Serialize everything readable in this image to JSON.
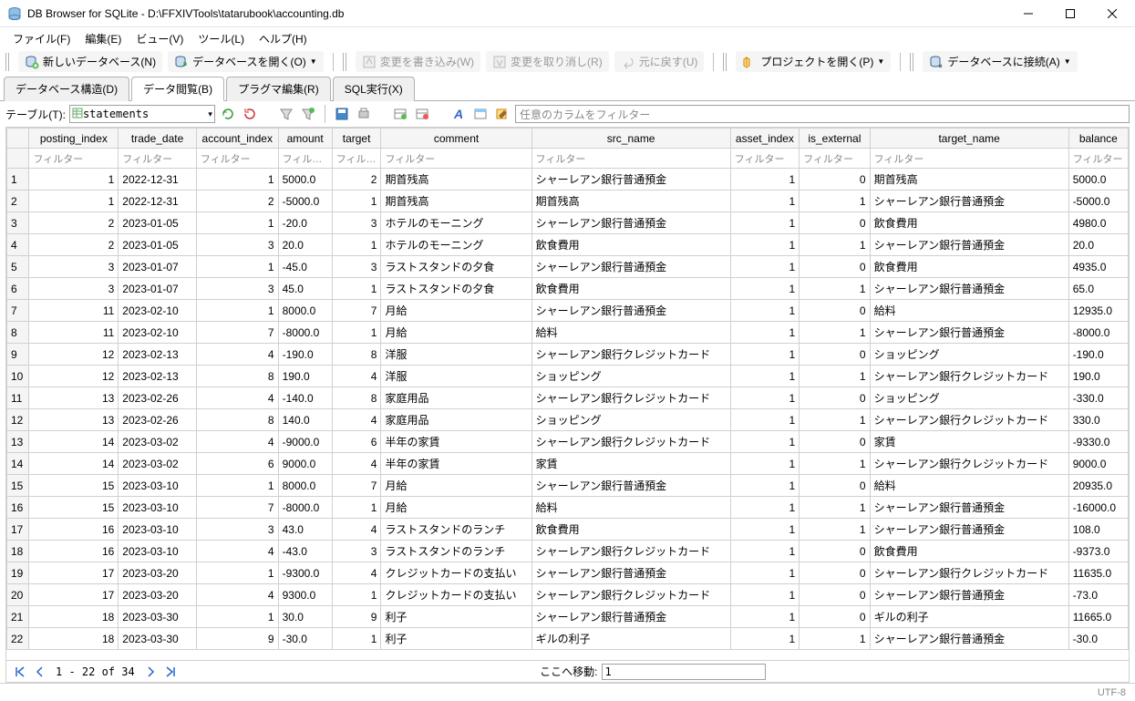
{
  "window": {
    "title": "DB Browser for SQLite - D:\\FFXIVTools\\tatarubook\\accounting.db"
  },
  "menus": {
    "file": "ファイル(F)",
    "edit": "編集(E)",
    "view": "ビュー(V)",
    "tools": "ツール(L)",
    "help": "ヘルプ(H)"
  },
  "toolbar": {
    "new_db": "新しいデータベース(N)",
    "open_db": "データベースを開く(O)",
    "write_changes": "変更を書き込み(W)",
    "revert_changes": "変更を取り消し(R)",
    "undo": "元に戻す(U)",
    "open_project": "プロジェクトを開く(P)",
    "attach_db": "データベースに接続(A)"
  },
  "tabs": {
    "structure": "データベース構造(D)",
    "browse": "データ閲覧(B)",
    "pragma": "プラグマ編集(R)",
    "sql": "SQL実行(X)"
  },
  "browse": {
    "table_label": "テーブル(T):",
    "table_name": "statements",
    "filter_placeholder": "任意のカラムをフィルター",
    "filter_cell": "フィルター",
    "filter_cell_short": "フィル…"
  },
  "columns": [
    "posting_index",
    "trade_date",
    "account_index",
    "amount",
    "target",
    "comment",
    "src_name",
    "asset_index",
    "is_external",
    "target_name",
    "balance"
  ],
  "rows": [
    {
      "n": "1",
      "posting_index": "1",
      "trade_date": "2022-12-31",
      "account_index": "1",
      "amount": "5000.0",
      "target": "2",
      "comment": "期首残高",
      "src_name": "シャーレアン銀行普通預金",
      "asset_index": "1",
      "is_external": "0",
      "target_name": "期首残高",
      "balance": "5000.0"
    },
    {
      "n": "2",
      "posting_index": "1",
      "trade_date": "2022-12-31",
      "account_index": "2",
      "amount": "-5000.0",
      "target": "1",
      "comment": "期首残高",
      "src_name": "期首残高",
      "asset_index": "1",
      "is_external": "1",
      "target_name": "シャーレアン銀行普通預金",
      "balance": "-5000.0"
    },
    {
      "n": "3",
      "posting_index": "2",
      "trade_date": "2023-01-05",
      "account_index": "1",
      "amount": "-20.0",
      "target": "3",
      "comment": "ホテルのモーニング",
      "src_name": "シャーレアン銀行普通預金",
      "asset_index": "1",
      "is_external": "0",
      "target_name": "飲食費用",
      "balance": "4980.0"
    },
    {
      "n": "4",
      "posting_index": "2",
      "trade_date": "2023-01-05",
      "account_index": "3",
      "amount": "20.0",
      "target": "1",
      "comment": "ホテルのモーニング",
      "src_name": "飲食費用",
      "asset_index": "1",
      "is_external": "1",
      "target_name": "シャーレアン銀行普通預金",
      "balance": "20.0"
    },
    {
      "n": "5",
      "posting_index": "3",
      "trade_date": "2023-01-07",
      "account_index": "1",
      "amount": "-45.0",
      "target": "3",
      "comment": "ラストスタンドの夕食",
      "src_name": "シャーレアン銀行普通預金",
      "asset_index": "1",
      "is_external": "0",
      "target_name": "飲食費用",
      "balance": "4935.0"
    },
    {
      "n": "6",
      "posting_index": "3",
      "trade_date": "2023-01-07",
      "account_index": "3",
      "amount": "45.0",
      "target": "1",
      "comment": "ラストスタンドの夕食",
      "src_name": "飲食費用",
      "asset_index": "1",
      "is_external": "1",
      "target_name": "シャーレアン銀行普通預金",
      "balance": "65.0"
    },
    {
      "n": "7",
      "posting_index": "11",
      "trade_date": "2023-02-10",
      "account_index": "1",
      "amount": "8000.0",
      "target": "7",
      "comment": "月給",
      "src_name": "シャーレアン銀行普通預金",
      "asset_index": "1",
      "is_external": "0",
      "target_name": "給料",
      "balance": "12935.0"
    },
    {
      "n": "8",
      "posting_index": "11",
      "trade_date": "2023-02-10",
      "account_index": "7",
      "amount": "-8000.0",
      "target": "1",
      "comment": "月給",
      "src_name": "給料",
      "asset_index": "1",
      "is_external": "1",
      "target_name": "シャーレアン銀行普通預金",
      "balance": "-8000.0"
    },
    {
      "n": "9",
      "posting_index": "12",
      "trade_date": "2023-02-13",
      "account_index": "4",
      "amount": "-190.0",
      "target": "8",
      "comment": "洋服",
      "src_name": "シャーレアン銀行クレジットカード",
      "asset_index": "1",
      "is_external": "0",
      "target_name": "ショッピング",
      "balance": "-190.0"
    },
    {
      "n": "10",
      "posting_index": "12",
      "trade_date": "2023-02-13",
      "account_index": "8",
      "amount": "190.0",
      "target": "4",
      "comment": "洋服",
      "src_name": "ショッピング",
      "asset_index": "1",
      "is_external": "1",
      "target_name": "シャーレアン銀行クレジットカード",
      "balance": "190.0"
    },
    {
      "n": "11",
      "posting_index": "13",
      "trade_date": "2023-02-26",
      "account_index": "4",
      "amount": "-140.0",
      "target": "8",
      "comment": "家庭用品",
      "src_name": "シャーレアン銀行クレジットカード",
      "asset_index": "1",
      "is_external": "0",
      "target_name": "ショッピング",
      "balance": "-330.0"
    },
    {
      "n": "12",
      "posting_index": "13",
      "trade_date": "2023-02-26",
      "account_index": "8",
      "amount": "140.0",
      "target": "4",
      "comment": "家庭用品",
      "src_name": "ショッピング",
      "asset_index": "1",
      "is_external": "1",
      "target_name": "シャーレアン銀行クレジットカード",
      "balance": "330.0"
    },
    {
      "n": "13",
      "posting_index": "14",
      "trade_date": "2023-03-02",
      "account_index": "4",
      "amount": "-9000.0",
      "target": "6",
      "comment": "半年の家賃",
      "src_name": "シャーレアン銀行クレジットカード",
      "asset_index": "1",
      "is_external": "0",
      "target_name": "家賃",
      "balance": "-9330.0"
    },
    {
      "n": "14",
      "posting_index": "14",
      "trade_date": "2023-03-02",
      "account_index": "6",
      "amount": "9000.0",
      "target": "4",
      "comment": "半年の家賃",
      "src_name": "家賃",
      "asset_index": "1",
      "is_external": "1",
      "target_name": "シャーレアン銀行クレジットカード",
      "balance": "9000.0"
    },
    {
      "n": "15",
      "posting_index": "15",
      "trade_date": "2023-03-10",
      "account_index": "1",
      "amount": "8000.0",
      "target": "7",
      "comment": "月給",
      "src_name": "シャーレアン銀行普通預金",
      "asset_index": "1",
      "is_external": "0",
      "target_name": "給料",
      "balance": "20935.0"
    },
    {
      "n": "16",
      "posting_index": "15",
      "trade_date": "2023-03-10",
      "account_index": "7",
      "amount": "-8000.0",
      "target": "1",
      "comment": "月給",
      "src_name": "給料",
      "asset_index": "1",
      "is_external": "1",
      "target_name": "シャーレアン銀行普通預金",
      "balance": "-16000.0"
    },
    {
      "n": "17",
      "posting_index": "16",
      "trade_date": "2023-03-10",
      "account_index": "3",
      "amount": "43.0",
      "target": "4",
      "comment": "ラストスタンドのランチ",
      "src_name": "飲食費用",
      "asset_index": "1",
      "is_external": "1",
      "target_name": "シャーレアン銀行普通預金",
      "balance": "108.0"
    },
    {
      "n": "18",
      "posting_index": "16",
      "trade_date": "2023-03-10",
      "account_index": "4",
      "amount": "-43.0",
      "target": "3",
      "comment": "ラストスタンドのランチ",
      "src_name": "シャーレアン銀行クレジットカード",
      "asset_index": "1",
      "is_external": "0",
      "target_name": "飲食費用",
      "balance": "-9373.0"
    },
    {
      "n": "19",
      "posting_index": "17",
      "trade_date": "2023-03-20",
      "account_index": "1",
      "amount": "-9300.0",
      "target": "4",
      "comment": "クレジットカードの支払い",
      "src_name": "シャーレアン銀行普通預金",
      "asset_index": "1",
      "is_external": "0",
      "target_name": "シャーレアン銀行クレジットカード",
      "balance": "11635.0"
    },
    {
      "n": "20",
      "posting_index": "17",
      "trade_date": "2023-03-20",
      "account_index": "4",
      "amount": "9300.0",
      "target": "1",
      "comment": "クレジットカードの支払い",
      "src_name": "シャーレアン銀行クレジットカード",
      "asset_index": "1",
      "is_external": "0",
      "target_name": "シャーレアン銀行普通預金",
      "balance": "-73.0"
    },
    {
      "n": "21",
      "posting_index": "18",
      "trade_date": "2023-03-30",
      "account_index": "1",
      "amount": "30.0",
      "target": "9",
      "comment": "利子",
      "src_name": "シャーレアン銀行普通預金",
      "asset_index": "1",
      "is_external": "0",
      "target_name": "ギルの利子",
      "balance": "11665.0"
    },
    {
      "n": "22",
      "posting_index": "18",
      "trade_date": "2023-03-30",
      "account_index": "9",
      "amount": "-30.0",
      "target": "1",
      "comment": "利子",
      "src_name": "ギルの利子",
      "asset_index": "1",
      "is_external": "1",
      "target_name": "シャーレアン銀行普通預金",
      "balance": "-30.0"
    }
  ],
  "pager": {
    "range": "1 - 22 of 34",
    "jump_label": "ここへ移動:",
    "jump_val": "1"
  },
  "status": {
    "encoding": "UTF-8"
  },
  "colwidths": {
    "rownum": 24,
    "posting_index": 96,
    "trade_date": 84,
    "account_index": 88,
    "amount": 58,
    "target": 42,
    "comment": 162,
    "src_name": 214,
    "asset_index": 74,
    "is_external": 76,
    "target_name": 214,
    "balance": 64
  }
}
